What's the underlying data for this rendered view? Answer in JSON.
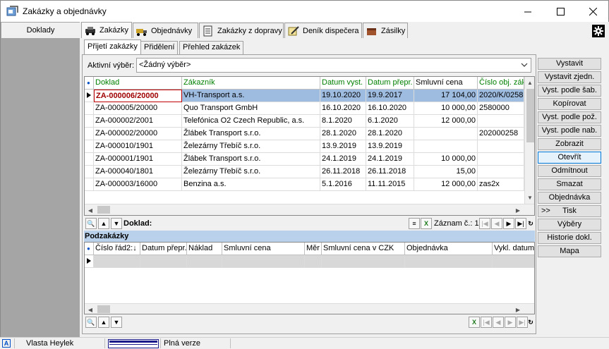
{
  "window": {
    "title": "Zakázky a objednávky",
    "buttons": {
      "minimize": "─",
      "maximize": "☐",
      "close": "✕"
    }
  },
  "left_panel": {
    "header": "Doklady"
  },
  "main_tabs": [
    {
      "label": "Zakázky",
      "icon": "car-icon",
      "active": true
    },
    {
      "label": "Objednávky",
      "icon": "truck-icon",
      "active": false
    },
    {
      "label": "Zakázky z dopravy",
      "icon": "document-icon",
      "active": false
    },
    {
      "label": "Deník dispečera",
      "icon": "pencil-icon",
      "active": false
    },
    {
      "label": "Zásilky",
      "icon": "package-icon",
      "active": false
    }
  ],
  "sub_tabs": [
    {
      "label": "Přijetí zakázky",
      "active": true
    },
    {
      "label": "Přidělení",
      "active": false
    },
    {
      "label": "Přehled zakázek",
      "active": false
    }
  ],
  "filter": {
    "label": "Aktivní výběr:",
    "value": "<Žádný výběr>"
  },
  "orders_grid": {
    "columns": [
      "Doklad",
      "Zákazník",
      "Datum vyst.",
      "Datum přepr.",
      "Smluvní cena",
      "Číslo obj. zák"
    ],
    "rows": [
      [
        "ZA-000006/20000",
        "VH-Transport a.s.",
        "19.10.2020",
        "19.9.2017",
        "17 104,00",
        "2020/K/0258"
      ],
      [
        "ZA-000005/20000",
        "Quo Transport  GmbH",
        "16.10.2020",
        "16.10.2020",
        "10 000,00",
        "2580000"
      ],
      [
        "ZA-000002/2001",
        "Telefónica O2 Czech Republic, a.s.",
        "8.1.2020",
        "6.1.2020",
        "12 000,00",
        ""
      ],
      [
        "ZA-000002/20000",
        "Žlábek Transport s.r.o.",
        "28.1.2020",
        "28.1.2020",
        "",
        "202000258"
      ],
      [
        "ZA-000010/1901",
        "Železárny Třebíč s.r.o.",
        "13.9.2019",
        "13.9.2019",
        "",
        ""
      ],
      [
        "ZA-000001/1901",
        "Žlábek Transport s.r.o.",
        "24.1.2019",
        "24.1.2019",
        "10 000,00",
        ""
      ],
      [
        "ZA-000040/1801",
        "Železárny Třebíč s.r.o.",
        "26.11.2018",
        "26.11.2018",
        "15,00",
        ""
      ],
      [
        "ZA-000003/16000",
        "Benzina a.s.",
        "5.1.2016",
        "11.11.2015",
        "12 000,00",
        "zas2x"
      ]
    ]
  },
  "orders_toolbar": {
    "label": "Doklad:",
    "record_label": "Záznam č.: 1"
  },
  "subgrid": {
    "title": "Podzakázky",
    "columns": [
      "Číslo řád2:↓",
      "Datum přepr.",
      "Náklad",
      "Smluvní cena",
      "Měr",
      "Smluvní cena v CZK",
      "Objednávka",
      "Vykl. datum"
    ]
  },
  "right_buttons": [
    "Vystavit",
    "Vystavit zjedn.",
    "Vyst. podle šab.",
    "Kopírovat",
    "Vyst. podle pož.",
    "Vyst. podle nab.",
    "Zobrazit",
    "Otevřít",
    "Odmítnout",
    "Smazat",
    "Objednávka",
    "Tisk",
    "Výběry",
    "Historie dokl.",
    "Mapa"
  ],
  "tisk_prefix": ">>",
  "status_bar": {
    "user": "Vlasta Heylek",
    "version": "Plná verze",
    "mode_letter": "A"
  },
  "colors": {
    "selection": "#9ebbe0",
    "header_text": "#008000",
    "section_bar": "#b9d1ea",
    "selected_doc": "#a00000"
  }
}
